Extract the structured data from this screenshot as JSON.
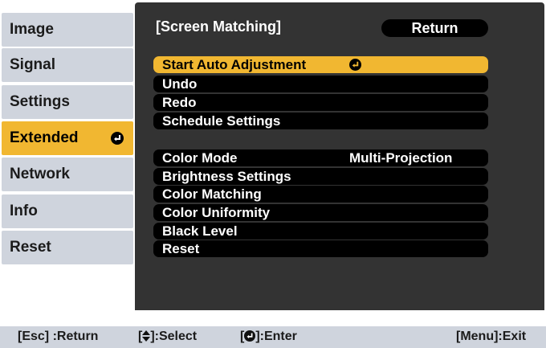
{
  "menu": {
    "items": [
      {
        "label": "Image"
      },
      {
        "label": "Signal"
      },
      {
        "label": "Settings"
      },
      {
        "label": "Extended"
      },
      {
        "label": "Network"
      },
      {
        "label": "Info"
      },
      {
        "label": "Reset"
      }
    ],
    "active_index": 3
  },
  "panel": {
    "title": "[Screen Matching]",
    "return_label": "Return",
    "items": [
      {
        "label": "Start Auto Adjustment",
        "selected": true
      },
      {
        "label": "Undo"
      },
      {
        "label": "Redo"
      },
      {
        "label": "Schedule Settings"
      },
      {
        "label": "Color Mode",
        "value": "Multi-Projection"
      },
      {
        "label": "Brightness Settings"
      },
      {
        "label": "Color Matching"
      },
      {
        "label": "Color Uniformity"
      },
      {
        "label": "Black Level"
      },
      {
        "label": "Reset"
      }
    ]
  },
  "help_bar": {
    "esc": "[Esc] :Return",
    "select_prefix": "[",
    "select_suffix": "]:Select",
    "enter_prefix": "[",
    "enter_suffix": "]:Enter",
    "menu": "[Menu]:Exit"
  },
  "colors": {
    "accent": "#f1b731",
    "panel_bg": "#333333",
    "menu_bg": "#cfd4dd",
    "item_bg": "#000000"
  },
  "icons": {
    "enter": "enter-icon",
    "select": "up-down-arrows-icon"
  }
}
